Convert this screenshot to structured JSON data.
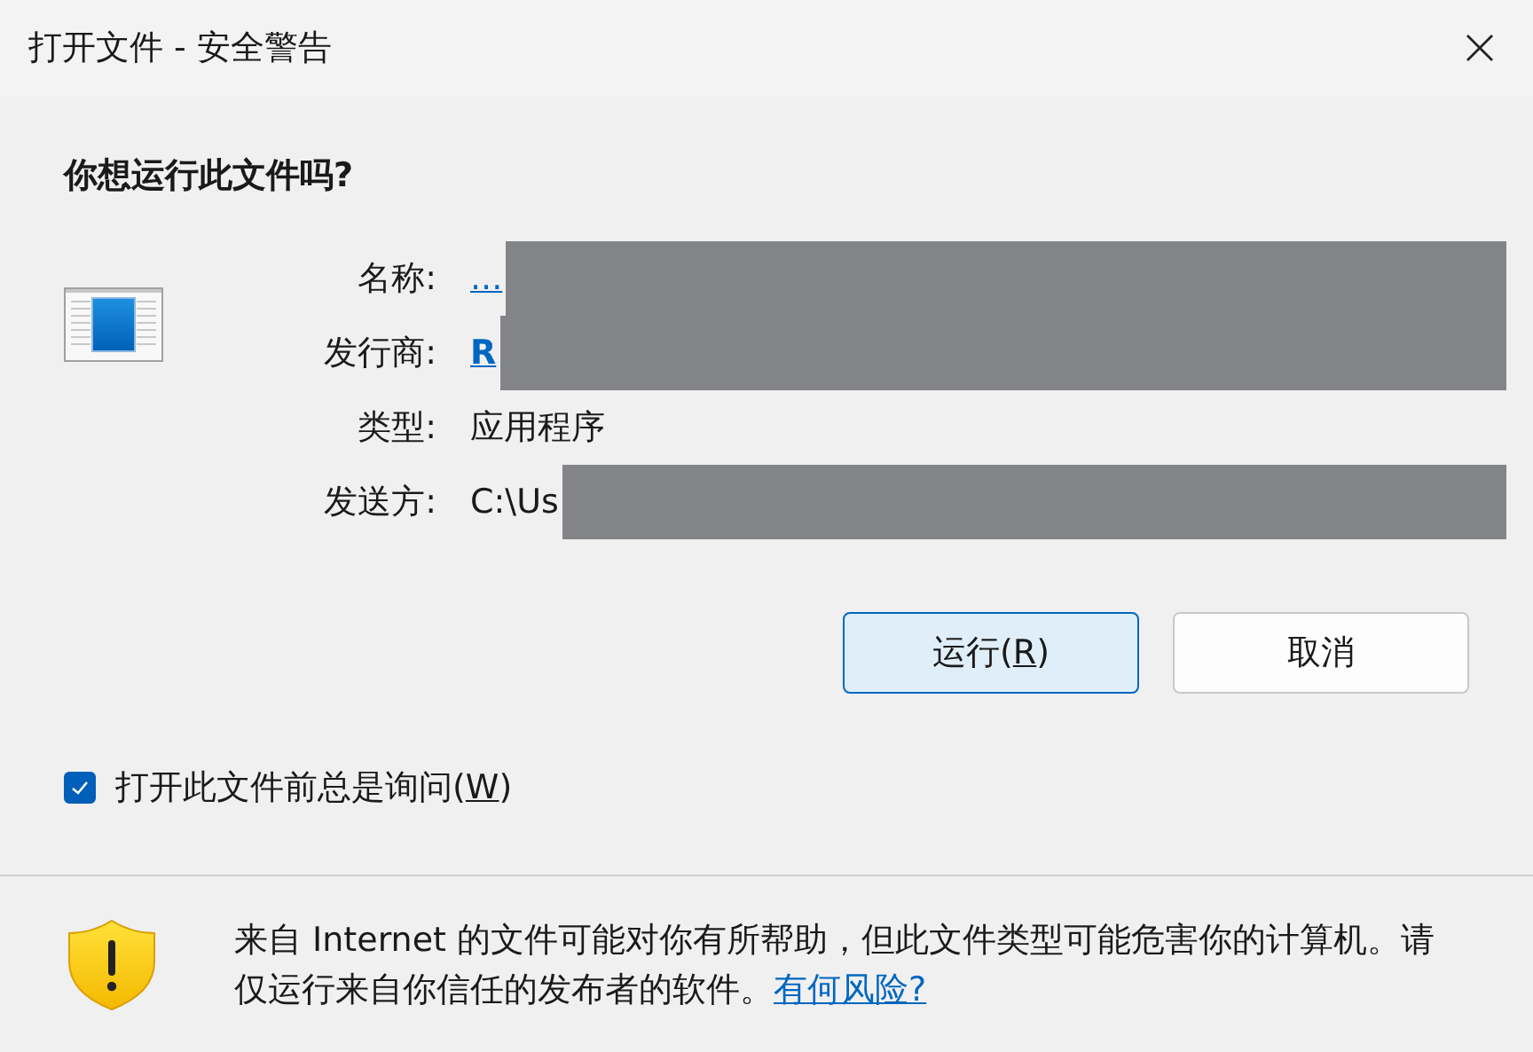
{
  "window": {
    "title": "打开文件 - 安全警告"
  },
  "heading": "你想运行此文件吗?",
  "fields": [
    {
      "label": "名称:",
      "value": "...",
      "link": true,
      "bold": false,
      "redacted": true
    },
    {
      "label": "发行商:",
      "value": "R",
      "link": true,
      "bold": true,
      "redacted": true
    },
    {
      "label": "类型:",
      "value": "应用程序",
      "link": false,
      "bold": false
    },
    {
      "label": "发送方:",
      "value": "C:\\Us",
      "link": false,
      "bold": false,
      "redacted": true
    }
  ],
  "buttons": [
    {
      "label": "运行(",
      "key": "R",
      "label_end": ")",
      "default": true
    },
    {
      "label": "取消",
      "default": false
    }
  ],
  "checkbox": {
    "label": "打开此文件前总是询问(",
    "key": "W",
    "label_end": ")",
    "checked": true
  },
  "warning": {
    "text": "来自 Internet 的文件可能对你有所帮助，但此文件类型可能危害你的计算机。请仅运行来自你信任的发布者的软件。",
    "link": "有何风险?"
  }
}
